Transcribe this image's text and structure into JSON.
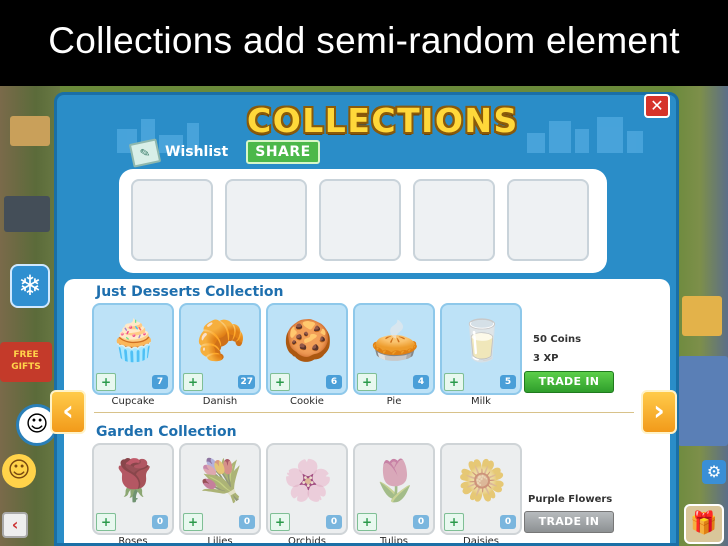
{
  "slide": {
    "title": "Collections add semi-random element"
  },
  "dialog": {
    "title": "COLLECTIONS",
    "close_glyph": "✕",
    "wishlist_label": "Wishlist",
    "share_label": "SHARE",
    "wishlist_slots": 5,
    "prev_glyph": "‹",
    "next_glyph": "›"
  },
  "collections": [
    {
      "title": "Just Desserts Collection",
      "items": [
        {
          "name": "Cupcake",
          "count": "7",
          "icon": "cupcake-icon",
          "glyph": "🧁"
        },
        {
          "name": "Danish",
          "count": "27",
          "icon": "danish-icon",
          "glyph": "🥐"
        },
        {
          "name": "Cookie",
          "count": "6",
          "icon": "cookie-icon",
          "glyph": "🍪"
        },
        {
          "name": "Pie",
          "count": "4",
          "icon": "pie-icon",
          "glyph": "🥧"
        },
        {
          "name": "Milk",
          "count": "5",
          "icon": "milk-icon",
          "glyph": "🥛"
        }
      ],
      "reward": [
        "50 Coins",
        "3 XP"
      ],
      "trade_label": "TRADE IN",
      "trade_enabled": true
    },
    {
      "title": "Garden Collection",
      "items": [
        {
          "name": "Roses",
          "count": "0",
          "icon": "rose-icon",
          "glyph": "🌹"
        },
        {
          "name": "Lilies",
          "count": "0",
          "icon": "lily-icon",
          "glyph": "💐"
        },
        {
          "name": "Orchids",
          "count": "0",
          "icon": "orchid-icon",
          "glyph": "🌸"
        },
        {
          "name": "Tulips",
          "count": "0",
          "icon": "tulip-icon",
          "glyph": "🌷"
        },
        {
          "name": "Daisies",
          "count": "0",
          "icon": "daisy-icon",
          "glyph": "🌼"
        }
      ],
      "reward": [
        "Purple Flowers"
      ],
      "trade_label": "TRADE IN",
      "trade_enabled": false
    }
  ],
  "hud": {
    "free_gifts_text": "FREE GIFTS",
    "snowflake_glyph": "❄",
    "avatar_glyph": "☺",
    "smiley_glyph": "☺",
    "left_btn_glyph": "‹",
    "gear_glyph": "⚙",
    "gift_glyph": "🎁"
  },
  "colors": {
    "dialog_blue": "#2a8dc8",
    "title_gold": "#ffd83a",
    "trade_green": "#2f9e2c",
    "arrow_orange": "#f29a1a"
  }
}
